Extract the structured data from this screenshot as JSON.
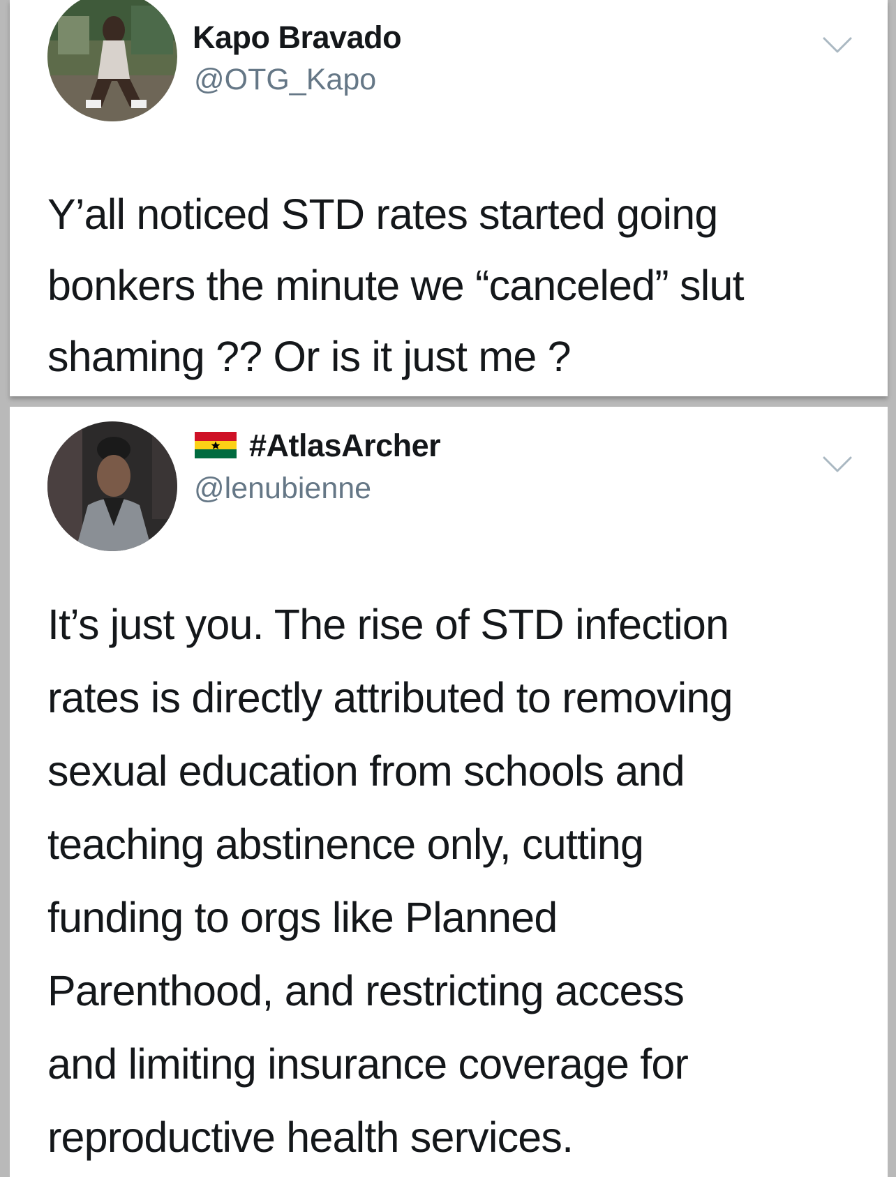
{
  "tweets": [
    {
      "display_name": "Kapo Bravado",
      "handle": "@OTG_Kapo",
      "text_lines": [
        "Y’all noticed STD rates started going",
        "bonkers the minute we “canceled” slut",
        "shaming ?? Or is it just me ?"
      ],
      "menu_icon": "chevron-down-icon"
    },
    {
      "display_name": "#AtlasArcher",
      "name_prefix_icon": "ghana-flag-icon",
      "handle": "@lenubienne",
      "text_lines": [
        "It’s just you. The rise of STD infection",
        "rates is directly attributed to removing",
        "sexual education from schools and",
        "teaching abstinence only, cutting",
        "funding to orgs like Planned",
        "Parenthood, and restricting access",
        "and limiting insurance coverage for",
        "reproductive health services."
      ],
      "menu_icon": "chevron-down-icon"
    }
  ],
  "colors": {
    "name": "#14171a",
    "handle": "#657786",
    "text": "#14171a",
    "chevron": "#aab8c2",
    "background": "#ffffff"
  }
}
